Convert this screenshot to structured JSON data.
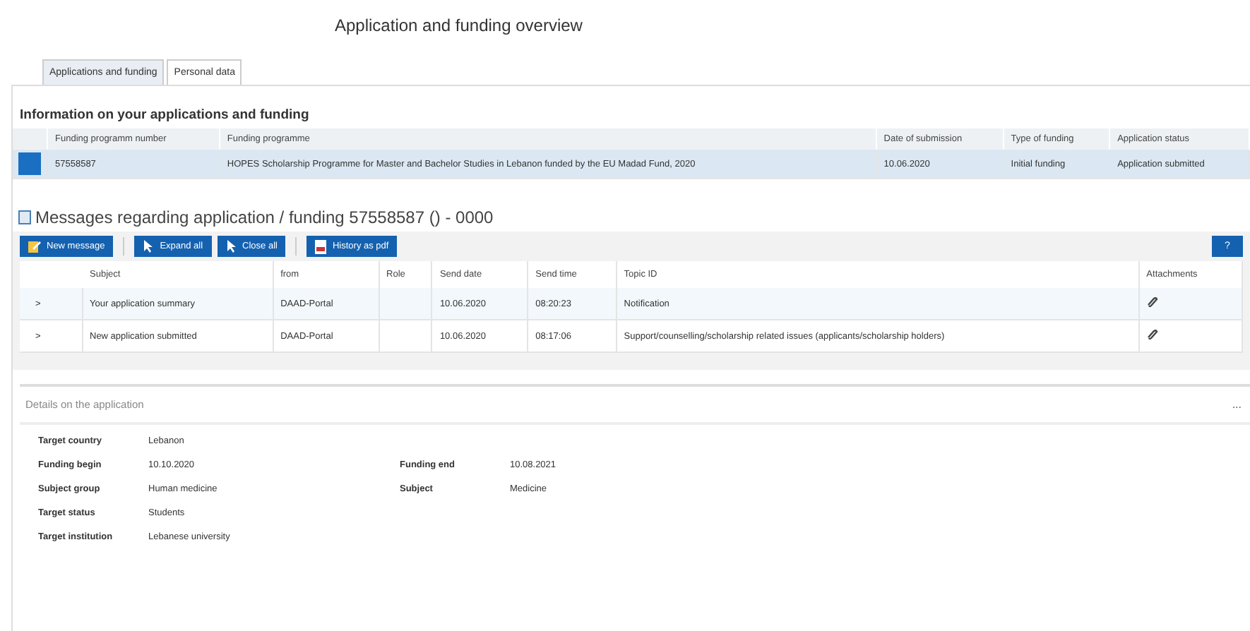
{
  "page_title": "Application and funding overview",
  "tabs": [
    {
      "label": "Applications and funding",
      "selected": true
    },
    {
      "label": "Personal data",
      "selected": false
    }
  ],
  "applications": {
    "heading": "Information on your applications and funding",
    "columns": [
      "Funding programm number",
      "Funding programme",
      "Date of submission",
      "Type of funding",
      "Application status"
    ],
    "rows": [
      {
        "selected": true,
        "cells": [
          "57558587",
          "HOPES Scholarship Programme for Master and Bachelor Studies in Lebanon funded by the EU Madad Fund, 2020",
          "10.06.2020",
          "Initial funding",
          "Application submitted"
        ]
      }
    ]
  },
  "messages": {
    "heading": "Messages regarding application / funding 57558587 () - 0000",
    "buttons": [
      {
        "label": "New message",
        "kind": "edit"
      },
      {
        "label": "Expand all",
        "kind": "expand"
      },
      {
        "label": "Close all",
        "kind": "collapse"
      },
      {
        "label": "History as pdf",
        "kind": "pdf"
      }
    ],
    "help_button": "?",
    "columns": [
      "Subject",
      "from",
      "Role",
      "Send date",
      "Send time",
      "Topic ID",
      "Attachments"
    ],
    "rows": [
      {
        "selected": true,
        "expander": ">",
        "cells": [
          "Your application summary",
          "DAAD-Portal",
          "",
          "10.06.2020",
          "08:20:23",
          "Notification"
        ],
        "attachment": true
      },
      {
        "selected": false,
        "expander": ">",
        "cells": [
          "New application submitted",
          "DAAD-Portal",
          "",
          "10.06.2020",
          "08:17:06",
          "Support/counselling/scholarship related issues (applicants/scholarship holders)"
        ],
        "attachment": true
      }
    ]
  },
  "details": {
    "heading": "Details on the application",
    "menu": "...",
    "rows": [
      [
        {
          "label": "Target country",
          "value": "Lebanon"
        }
      ],
      [
        {
          "label": "Funding begin",
          "value": "10.10.2020"
        },
        {
          "label": "Funding end",
          "value": "10.08.2021"
        }
      ],
      [
        {
          "label": "Subject group",
          "value": "Human medicine"
        },
        {
          "label": "Subject",
          "value": "Medicine"
        }
      ],
      [
        {
          "label": "Target status",
          "value": "Students"
        }
      ],
      [
        {
          "label": "Target institution",
          "value": "Lebanese university"
        }
      ]
    ]
  }
}
